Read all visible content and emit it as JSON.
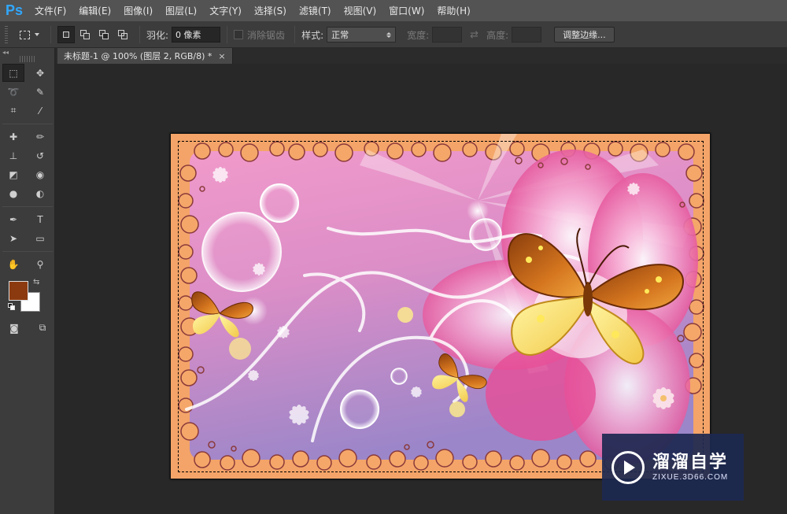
{
  "app": {
    "logo": "Ps"
  },
  "menu": [
    "文件(F)",
    "编辑(E)",
    "图像(I)",
    "图层(L)",
    "文字(Y)",
    "选择(S)",
    "滤镜(T)",
    "视图(V)",
    "窗口(W)",
    "帮助(H)"
  ],
  "options": {
    "feather_label": "羽化:",
    "feather_value": "0 像素",
    "antialias_label": "消除锯齿",
    "style_label": "样式:",
    "style_value": "正常",
    "width_label": "宽度:",
    "height_label": "高度:",
    "refine_edge_label": "调整边缘..."
  },
  "toolbox": {
    "collapse_label": "◂◂",
    "tools": [
      {
        "name": "rect-marquee-tool-icon",
        "glyph": "⬚",
        "selected": true
      },
      {
        "name": "move-tool-icon",
        "glyph": "✥"
      },
      {
        "name": "lasso-tool-icon",
        "glyph": "➰"
      },
      {
        "name": "quick-selection-tool-icon",
        "glyph": "✎"
      },
      {
        "name": "crop-tool-icon",
        "glyph": "⌗"
      },
      {
        "name": "eyedropper-tool-icon",
        "glyph": "⁄"
      },
      {
        "name": "healing-brush-tool-icon",
        "glyph": "✚"
      },
      {
        "name": "brush-tool-icon",
        "glyph": "✏"
      },
      {
        "name": "clone-stamp-tool-icon",
        "glyph": "⊥"
      },
      {
        "name": "history-brush-tool-icon",
        "glyph": "↺"
      },
      {
        "name": "eraser-tool-icon",
        "glyph": "◩"
      },
      {
        "name": "paint-bucket-tool-icon",
        "glyph": "◉"
      },
      {
        "name": "blur-tool-icon",
        "glyph": "●"
      },
      {
        "name": "dodge-tool-icon",
        "glyph": "◐"
      },
      {
        "name": "pen-tool-icon",
        "glyph": "✒"
      },
      {
        "name": "type-tool-icon",
        "glyph": "T"
      },
      {
        "name": "path-selection-tool-icon",
        "glyph": "➤"
      },
      {
        "name": "rectangle-shape-tool-icon",
        "glyph": "▭"
      },
      {
        "name": "hand-tool-icon",
        "glyph": "✋"
      },
      {
        "name": "zoom-tool-icon",
        "glyph": "⚲"
      }
    ],
    "foreground_color": "#8b3a0f",
    "background_color": "#ffffff"
  },
  "document": {
    "tab_title": "未标题-1 @ 100% (图层 2, RGB/8) *",
    "close_glyph": "×"
  },
  "watermark": {
    "title": "溜溜自学",
    "url": "ZIXUE.3D66.COM"
  },
  "colors": {
    "canvas_border": "#f4a468",
    "pink_light": "#f7b8d6",
    "pink_deep": "#e0428f",
    "purple": "#9a86c8",
    "butterfly_orange": "#c0661a",
    "butterfly_yellow": "#f7e36a"
  }
}
